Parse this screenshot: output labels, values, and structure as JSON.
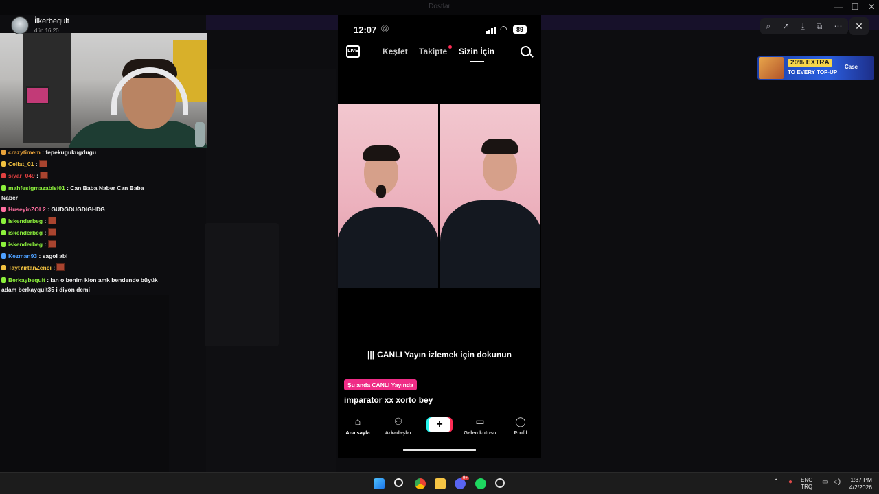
{
  "window": {
    "title": "Dostlar"
  },
  "viewer": {
    "close_label": "✕"
  },
  "ad": {
    "badge": "20% EXTRA",
    "line": "TO EVERY TOP-UP",
    "brand": "Case"
  },
  "channel": {
    "name": "İlkerbequit",
    "sub": "dün 16:20"
  },
  "chat": [
    {
      "user": "crazytimem",
      "user_color": "#e8a23a",
      "message": ": fepekugukugdugu"
    },
    {
      "user": "Cellat_01",
      "user_color": "#f0c040",
      "message": ":",
      "emote": true
    },
    {
      "user": "siyar_049",
      "user_color": "#e04040",
      "message": ":",
      "emote": true
    },
    {
      "user": "mahfesigmazabisi01",
      "user_color": "#8cf03c",
      "message": ": Can Baba Naber Can Baba Naber"
    },
    {
      "user": "HuseyinZOL2",
      "user_color": "#ff6fa0",
      "message": ": GUDGDUGDIGHDG"
    },
    {
      "user": "iskenderbeg",
      "user_color": "#8cf03c",
      "message": ":",
      "emote": true
    },
    {
      "user": "iskenderbeg",
      "user_color": "#8cf03c",
      "message": ":",
      "emote": true
    },
    {
      "user": "iskenderbeg",
      "user_color": "#8cf03c",
      "message": ":",
      "emote": true
    },
    {
      "user": "Kezman93",
      "user_color": "#4ea0ff",
      "message": ": sagol abi"
    },
    {
      "user": "TaytYirtanZenci",
      "user_color": "#f0c040",
      "message": ":",
      "emote": true
    },
    {
      "user": "Berkaybequit",
      "user_color": "#8cf03c",
      "message": ": lan o benim klon amk bendende büyük adam berkayquit35 i diyon demi"
    }
  ],
  "phone": {
    "time": "12:07",
    "battery": "89",
    "live_label": "LIVE",
    "tabs": [
      "Keşfet",
      "Takipte",
      "Sizin İçin"
    ],
    "live_prompt": "CANLI Yayın izlemek için dokunun",
    "now_badge": "Şu anda CANLI Yayında",
    "now_title": "imparator xx xorto bey",
    "nav": [
      "Ana sayfa",
      "Arkadaşlar",
      "+",
      "Gelen kutusu",
      "Profil"
    ]
  },
  "taskbar": {
    "lang_top": "ENG",
    "lang_bottom": "TRQ",
    "time": "1:37 PM",
    "date": "4/2/2026",
    "discord_badge": "9+"
  }
}
